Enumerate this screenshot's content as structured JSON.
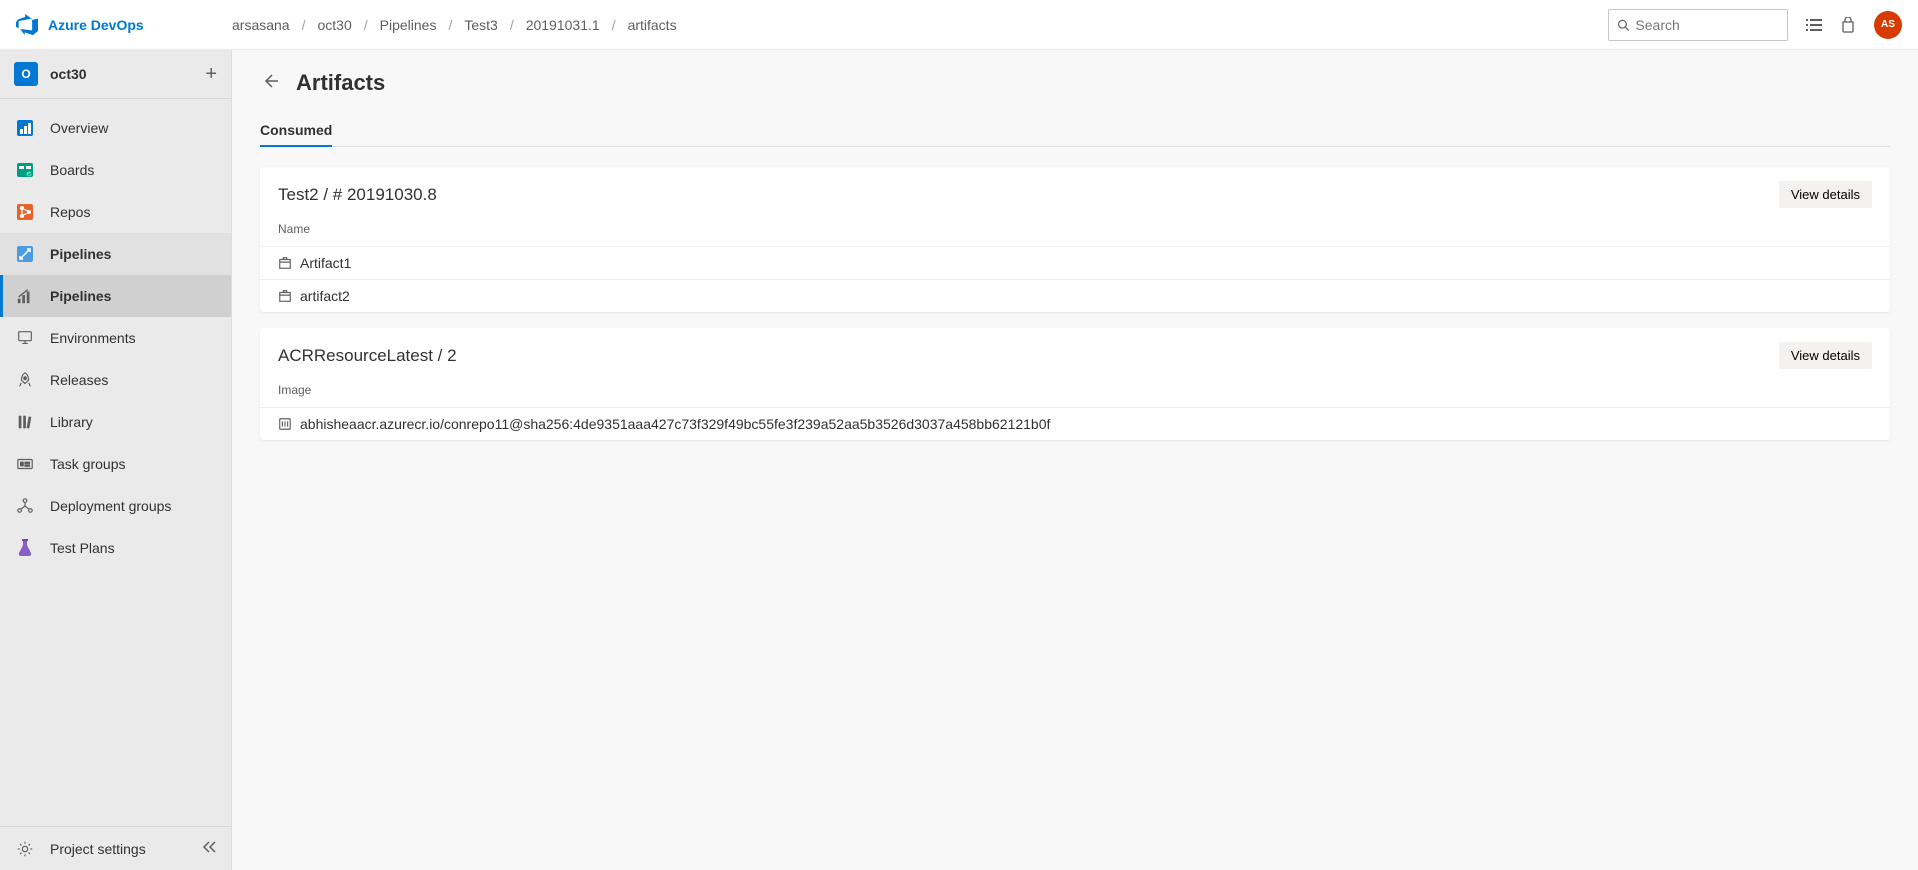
{
  "header": {
    "product": "Azure DevOps",
    "breadcrumb": [
      "arsasana",
      "oct30",
      "Pipelines",
      "Test3",
      "20191031.1",
      "artifacts"
    ],
    "search_placeholder": "Search",
    "avatar": "AS"
  },
  "sidebar": {
    "project_initial": "O",
    "project_name": "oct30",
    "items": {
      "overview": "Overview",
      "boards": "Boards",
      "repos": "Repos",
      "pipelines": "Pipelines",
      "pipelines_sub": "Pipelines",
      "environments": "Environments",
      "releases": "Releases",
      "library": "Library",
      "task_groups": "Task groups",
      "deployment_groups": "Deployment groups",
      "test_plans": "Test Plans"
    },
    "footer": "Project settings"
  },
  "main": {
    "title": "Artifacts",
    "tab": "Consumed",
    "view_details": "View details",
    "group1": {
      "title": "Test2 / # 20191030.8",
      "col": "Name",
      "rows": [
        "Artifact1",
        "artifact2"
      ]
    },
    "group2": {
      "title": "ACRResourceLatest / 2",
      "col": "Image",
      "rows": [
        "abhisheaacr.azurecr.io/conrepo11@sha256:4de9351aaa427c73f329f49bc55fe3f239a52aa5b3526d3037a458bb62121b0f"
      ]
    }
  }
}
